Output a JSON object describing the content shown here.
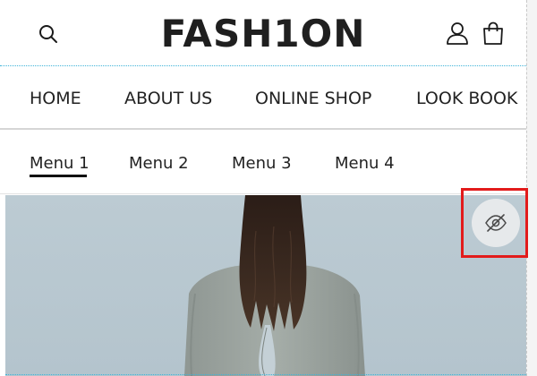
{
  "brand": {
    "logo_text": "FASH1ON"
  },
  "header": {
    "search_icon": "search-icon",
    "user_icon": "user-icon",
    "bag_icon": "shopping-bag-icon"
  },
  "main_nav": {
    "items": [
      {
        "label": "HOME"
      },
      {
        "label": "ABOUT US"
      },
      {
        "label": "ONLINE SHOP"
      },
      {
        "label": "LOOK BOOK"
      }
    ]
  },
  "sub_menu": {
    "items": [
      {
        "label": "Menu 1",
        "active": true
      },
      {
        "label": "Menu 2",
        "active": false
      },
      {
        "label": "Menu 3",
        "active": false
      },
      {
        "label": "Menu 4",
        "active": false
      }
    ]
  },
  "hero": {
    "subject": "woman with long dark hair seen from behind in grey sweater",
    "background_color": "#bccbd3"
  },
  "toggle": {
    "icon": "eye-slash-icon",
    "highlight_color": "#e21b1b"
  }
}
